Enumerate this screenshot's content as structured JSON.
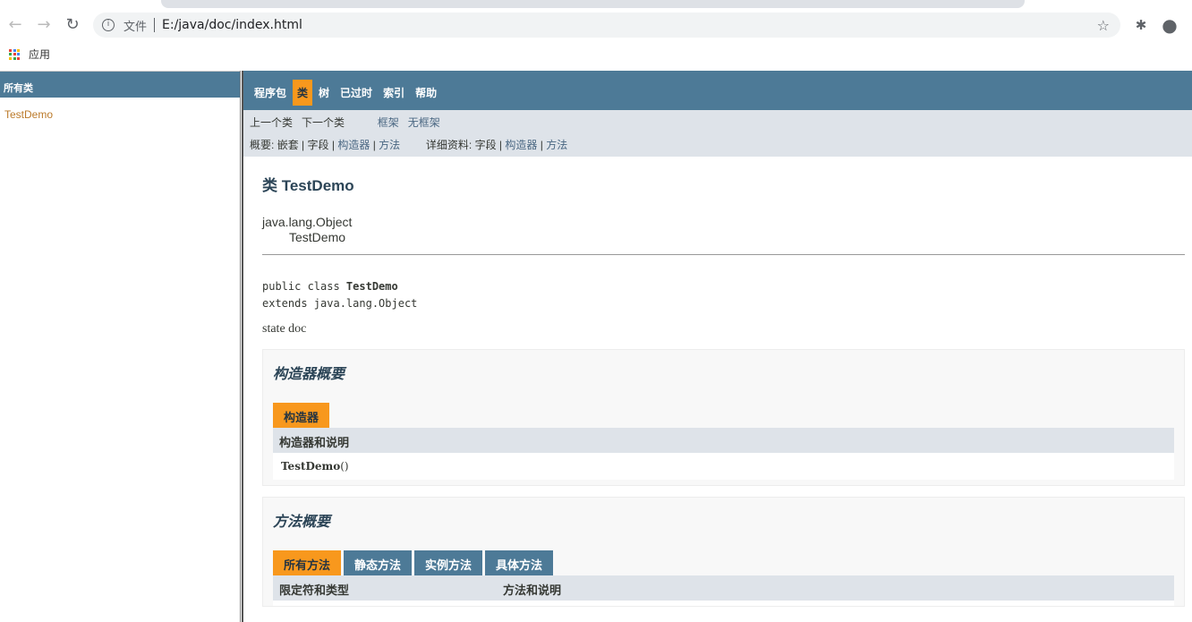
{
  "browser": {
    "url_scheme_label": "文件",
    "url": "E:/java/doc/index.html",
    "bookmark": "应用"
  },
  "left_frame": {
    "title": "所有类",
    "classes": [
      "TestDemo"
    ]
  },
  "topnav": [
    "程序包",
    "类",
    "树",
    "已过时",
    "索引",
    "帮助"
  ],
  "subnav": {
    "prev": "上一个类",
    "next": "下一个类",
    "frames": "框架",
    "noframes": "无框架",
    "summary_label": "概要:",
    "summary": [
      "嵌套",
      "字段",
      "构造器",
      "方法"
    ],
    "detail_label": "详细资料:",
    "detail": [
      "字段",
      "构造器",
      "方法"
    ],
    "sep": "|"
  },
  "class": {
    "title": "类 TestDemo",
    "parent": "java.lang.Object",
    "name": "TestDemo",
    "sig_prefix": "public class ",
    "sig_name": "TestDemo",
    "sig_extends": "extends java.lang.Object",
    "doc": "state doc"
  },
  "ctor": {
    "heading": "构造器概要",
    "caption": "构造器",
    "header": "构造器和说明",
    "name": "TestDemo",
    "args": "()"
  },
  "methods": {
    "heading": "方法概要",
    "tabs": [
      "所有方法",
      "静态方法",
      "实例方法",
      "具体方法"
    ],
    "col1": "限定符和类型",
    "col2": "方法和说明"
  }
}
